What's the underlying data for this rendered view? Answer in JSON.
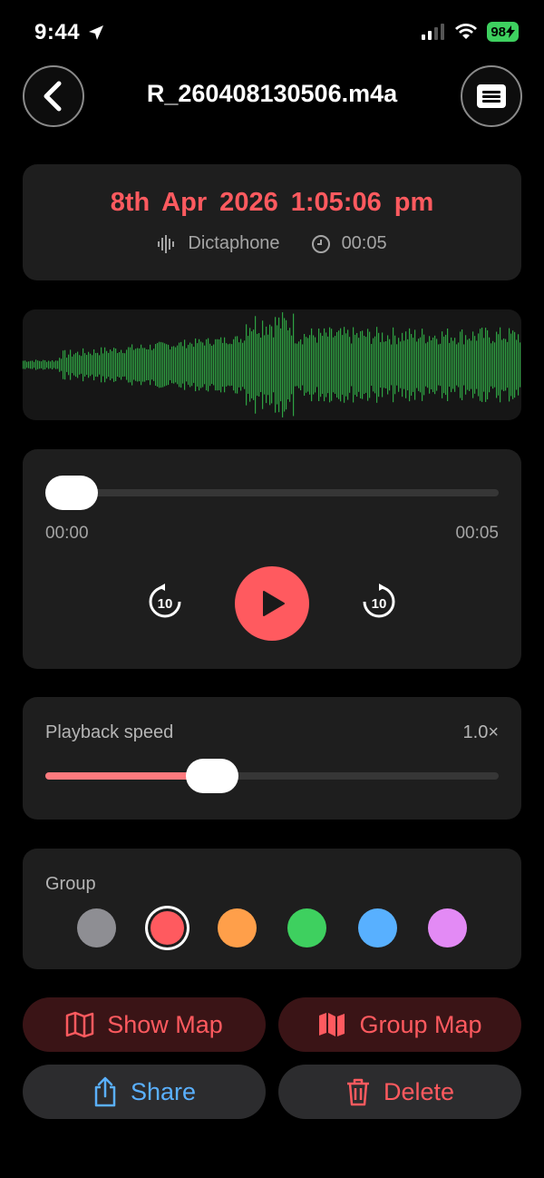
{
  "status": {
    "time": "9:44",
    "battery": "98"
  },
  "header": {
    "title": "R_260408130506.m4a"
  },
  "recording": {
    "date": "8th Apr 2026  1:05:06 pm",
    "source": "Dictaphone",
    "duration": "00:05"
  },
  "player": {
    "current": "00:00",
    "total": "00:05",
    "progress": 0.0
  },
  "speed": {
    "label": "Playback speed",
    "value": "1.0×",
    "fraction": 0.35
  },
  "group": {
    "label": "Group",
    "colors": [
      "#8e8e93",
      "#ff5a5f",
      "#ff9f4a",
      "#3ed05f",
      "#58b0ff",
      "#e38af5"
    ],
    "selected_index": 1
  },
  "actions": {
    "show_map": "Show Map",
    "group_map": "Group Map",
    "share": "Share",
    "delete": "Delete"
  },
  "colors": {
    "accent": "#ff5a5f",
    "waveform": "#2fa343",
    "share": "#5ab0ff"
  }
}
